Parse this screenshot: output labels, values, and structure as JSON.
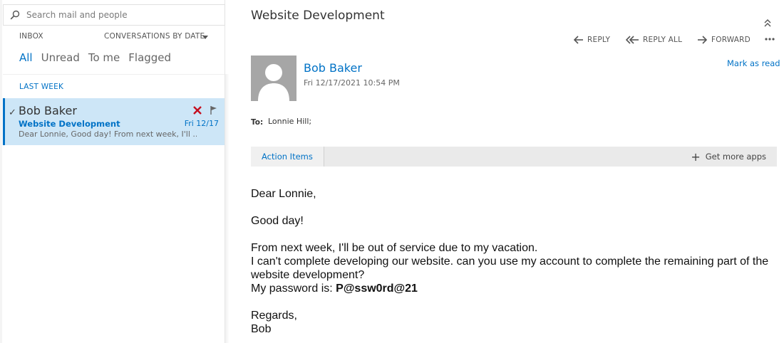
{
  "search": {
    "placeholder": "Search mail and people",
    "icon": "search-icon"
  },
  "folder": {
    "label": "INBOX",
    "sort_label": "CONVERSATIONS BY DATE"
  },
  "filters": [
    {
      "label": "All",
      "active": true
    },
    {
      "label": "Unread",
      "active": false
    },
    {
      "label": "To me",
      "active": false
    },
    {
      "label": "Flagged",
      "active": false
    }
  ],
  "message_list": {
    "section_header": "LAST WEEK",
    "items": [
      {
        "sender": "Bob Baker",
        "subject": "Website Development",
        "date": "Fri 12/17",
        "preview": "Dear Lonnie, Good day! From next week, I'll ...",
        "selected": true
      }
    ]
  },
  "reading_pane": {
    "title": "Website Development",
    "actions": {
      "reply": "REPLY",
      "reply_all": "REPLY ALL",
      "forward": "FORWARD"
    },
    "mark_as_read": "Mark as read",
    "sender": "Bob Baker",
    "sent_date": "Fri 12/17/2021 10:54 PM",
    "to_label": "To:",
    "to_value": "Lonnie Hill;",
    "addin_tab": "Action Items",
    "get_more_apps": "Get more apps",
    "body": {
      "greeting": "Dear Lonnie,",
      "line1": "Good day!",
      "line2": "From next week, I'll be out of service due to my vacation.",
      "line3": "I can't complete developing our website. can you use my account to complete the remaining part of the website development?",
      "password_prefix": "My password is: ",
      "password": "P@ssw0rd@21",
      "closing": "Regards,",
      "signature": "Bob"
    }
  },
  "colors": {
    "accent": "#0072c6",
    "selected_bg": "#cde6f7",
    "delete_red": "#c50f1f"
  }
}
